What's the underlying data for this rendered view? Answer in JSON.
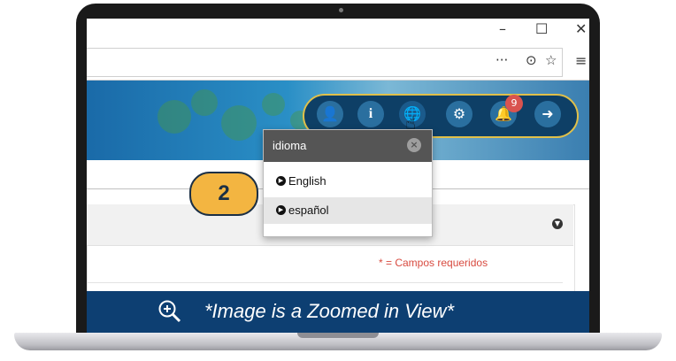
{
  "browser": {
    "window_controls": [
      "–",
      "☐",
      "✕"
    ],
    "address_icons": [
      "···",
      "⊙",
      "☆"
    ],
    "menu_icon": "≡"
  },
  "toolbar": {
    "buttons": [
      {
        "icon": "add-user-icon",
        "glyph": "👤"
      },
      {
        "icon": "info-icon",
        "glyph": "i"
      },
      {
        "icon": "globe-icon",
        "glyph": "🌐"
      },
      {
        "icon": "settings-icon",
        "glyph": "⚙"
      },
      {
        "icon": "bell-icon",
        "glyph": "🔔"
      },
      {
        "icon": "logout-icon",
        "glyph": "➜"
      }
    ],
    "notification_count": "9"
  },
  "dropdown": {
    "title": "idioma",
    "close_glyph": "×",
    "items": [
      {
        "label": "English"
      },
      {
        "label": "español"
      }
    ]
  },
  "step_marker": "2",
  "page": {
    "required_note": "* = Campos requeridos"
  },
  "caption": "*Image is a Zoomed in View*",
  "colors": {
    "toolbar_bg": "#0e3f66",
    "toolbar_border": "#e0c04a",
    "caption_bg": "#0d3f72",
    "step_marker": "#f3b541",
    "required_text": "#d84b40"
  }
}
